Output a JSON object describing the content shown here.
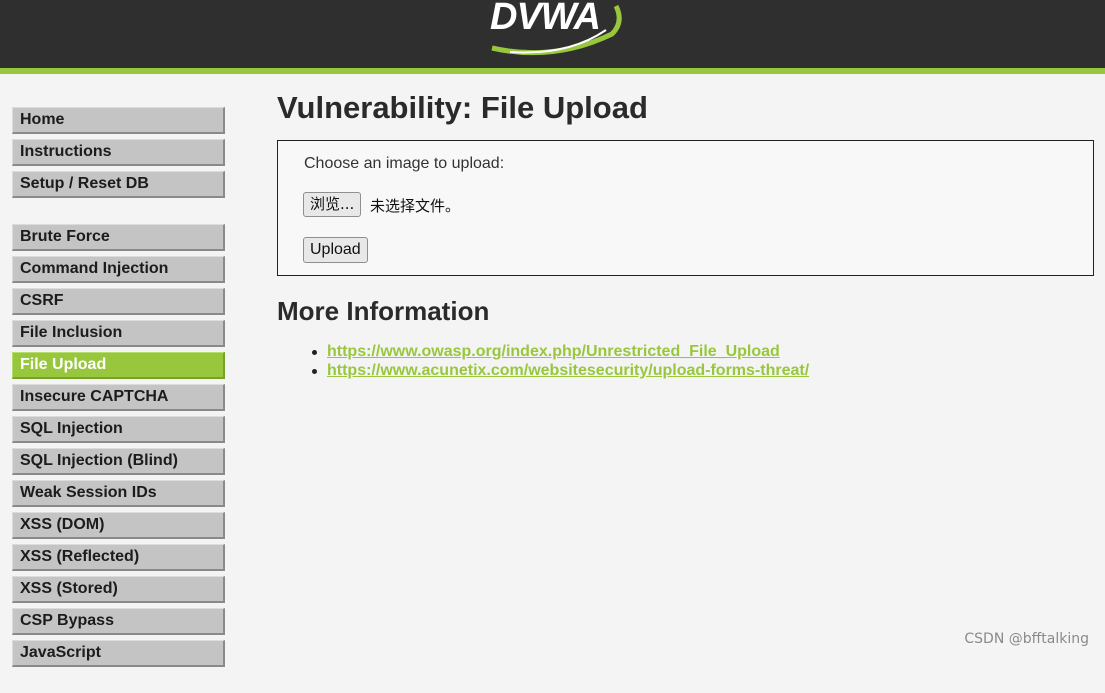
{
  "header": {
    "logo_text": "DVWA"
  },
  "colors": {
    "accent": "#98c73d",
    "header_bg": "#2f2f2f",
    "menu_bg": "#c4c4c4",
    "page_bg": "#f4f4f4"
  },
  "sidebar": {
    "group1": [
      {
        "label": "Home"
      },
      {
        "label": "Instructions"
      },
      {
        "label": "Setup / Reset DB"
      }
    ],
    "group2": [
      {
        "label": "Brute Force"
      },
      {
        "label": "Command Injection"
      },
      {
        "label": "CSRF"
      },
      {
        "label": "File Inclusion"
      },
      {
        "label": "File Upload",
        "selected": true
      },
      {
        "label": "Insecure CAPTCHA"
      },
      {
        "label": "SQL Injection"
      },
      {
        "label": "SQL Injection (Blind)"
      },
      {
        "label": "Weak Session IDs"
      },
      {
        "label": "XSS (DOM)"
      },
      {
        "label": "XSS (Reflected)"
      },
      {
        "label": "XSS (Stored)"
      },
      {
        "label": "CSP Bypass"
      },
      {
        "label": "JavaScript"
      }
    ]
  },
  "main": {
    "title": "Vulnerability: File Upload",
    "upload_form": {
      "prompt": "Choose an image to upload:",
      "browse_label": "浏览...",
      "no_file_label": "未选择文件。",
      "upload_label": "Upload"
    },
    "more_info": {
      "heading": "More Information",
      "links": [
        "https://www.owasp.org/index.php/Unrestricted_File_Upload",
        "https://www.acunetix.com/websitesecurity/upload-forms-threat/"
      ]
    }
  },
  "watermark": "CSDN @bfftalking"
}
